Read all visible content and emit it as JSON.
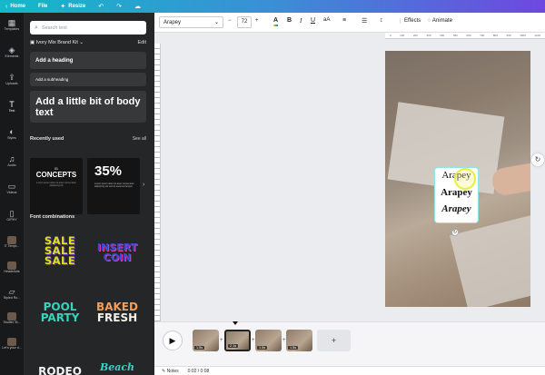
{
  "topbar": {
    "items": [
      {
        "label": "Home",
        "icon": "chevron-left-icon"
      },
      {
        "label": "File"
      },
      {
        "label": "Resize",
        "icon": "sparkle-icon"
      }
    ],
    "icons": [
      "undo-icon",
      "redo-icon",
      "cloud-icon"
    ]
  },
  "sidebar": {
    "items": [
      {
        "label": "Templates"
      },
      {
        "label": "Elements"
      },
      {
        "label": "Uploads"
      },
      {
        "label": "Text"
      },
      {
        "label": "Styles"
      },
      {
        "label": "Audio"
      },
      {
        "label": "Videos"
      },
      {
        "label": "GIPHY"
      },
      {
        "label": "IT Templ..."
      },
      {
        "label": "Headshots"
      },
      {
        "label": "Styled Ro..."
      },
      {
        "label": "Shutter St..."
      },
      {
        "label": "Let's your d..."
      }
    ]
  },
  "panel": {
    "search_placeholder": "Search text",
    "brand_kit": "Ivory Mix Brand Kit",
    "edit_label": "Edit",
    "heading": "Add a heading",
    "subheading": "Add a subheading",
    "body_text": "Add a little bit of body text",
    "recently_used_label": "Recently used",
    "see_all_label": "See all",
    "recent1": {
      "small": "01",
      "big": "CONCEPTS",
      "fine": "Lorem ipsum dolor sit amet consectetur adipiscing elit"
    },
    "recent2": {
      "big": "35%",
      "fine": "Lorem ipsum dolor sit amet consectetur adipiscing elit sed do eiusmod tempor"
    },
    "font_combinations_label": "Font combinations",
    "combos": [
      {
        "lines": [
          "SALE",
          "SALE",
          "SALE"
        ]
      },
      {
        "lines": [
          "INSERT",
          "COIN"
        ]
      },
      {
        "lines": [
          "POOL",
          "PARTY"
        ]
      },
      {
        "lines": [
          "BAKED",
          "FRESH"
        ]
      },
      {
        "lines": [
          "RODEO"
        ]
      },
      {
        "lines": [
          "Beach"
        ]
      }
    ]
  },
  "toolbar": {
    "font": "Arapey",
    "size": "72",
    "decrease": "−",
    "increase": "+",
    "color_label": "A",
    "bold": "B",
    "italic": "I",
    "underline": "U",
    "case": "aA",
    "effects": "Effects",
    "animate": "Animate"
  },
  "ruler": {
    "ticks": [
      "0",
      "100",
      "200",
      "300",
      "400",
      "500",
      "600",
      "700",
      "800",
      "900",
      "1000",
      "1100"
    ]
  },
  "canvas": {
    "text_lines": [
      "Arapey",
      "Arapey",
      "Arapey"
    ]
  },
  "timeline": {
    "clips": [
      {
        "duration": "1.5s"
      },
      {
        "duration": "2.1s",
        "selected": true
      },
      {
        "duration": "1.5s"
      },
      {
        "duration": "1.5s"
      }
    ],
    "add_label": "+"
  },
  "bottombar": {
    "notes_label": "Notes",
    "time": "0:02 / 0:08"
  }
}
